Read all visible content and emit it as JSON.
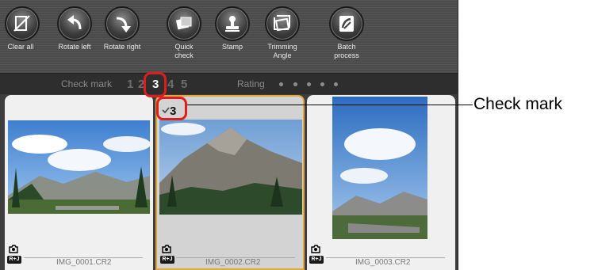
{
  "toolbar": {
    "buttons": [
      {
        "label": "Clear all",
        "icon": "clear-all-icon"
      },
      {
        "label": "Rotate left",
        "icon": "rotate-left-icon"
      },
      {
        "label": "Rotate right",
        "icon": "rotate-right-icon"
      },
      {
        "label": "Quick\ncheck",
        "icon": "quick-check-icon"
      },
      {
        "label": "Stamp",
        "icon": "stamp-icon"
      },
      {
        "label": "Trimming\nAngle",
        "icon": "trimming-angle-icon"
      },
      {
        "label": "Batch\nprocess",
        "icon": "batch-process-icon"
      }
    ]
  },
  "filter_bar": {
    "check_mark_label": "Check mark",
    "check_numbers": [
      "1",
      "2",
      "3",
      "4",
      "5"
    ],
    "active_check": "3",
    "rating_label": "Rating",
    "rating_dots": 5
  },
  "thumbnails": [
    {
      "filename": "IMG_0001.CR2",
      "selected": false,
      "check": "",
      "badge": "R+J",
      "camera_icon": "camera-icon"
    },
    {
      "filename": "IMG_0002.CR2",
      "selected": true,
      "check": "3",
      "badge": "R+J",
      "camera_icon": "camera-icon"
    },
    {
      "filename": "IMG_0003.CR2",
      "selected": false,
      "check": "",
      "badge": "R+J",
      "camera_icon": "camera-icon"
    }
  ],
  "callout": {
    "text": "Check mark"
  },
  "colors": {
    "highlight": "#e01c1c",
    "selection": "#e2a63a"
  }
}
